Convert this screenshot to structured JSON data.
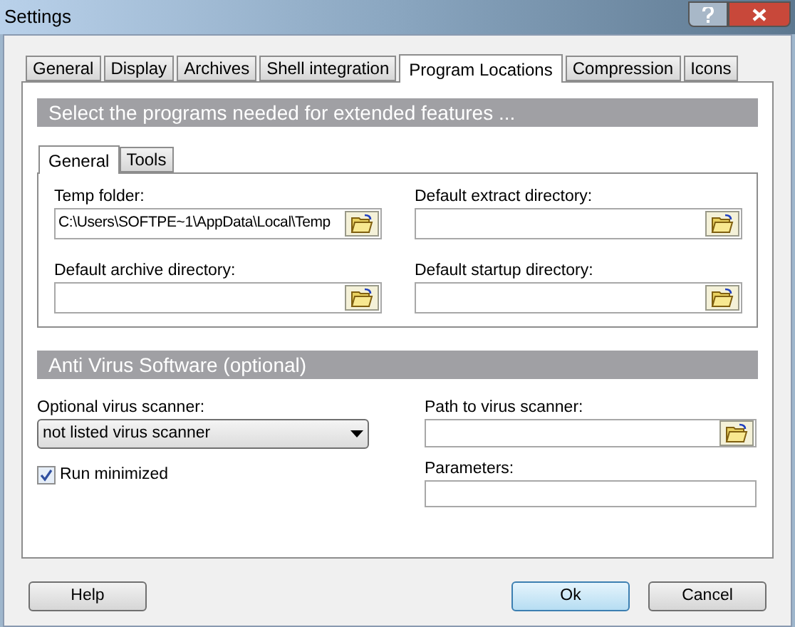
{
  "window": {
    "title": "Settings"
  },
  "tabs": [
    {
      "label": "General",
      "selected": false
    },
    {
      "label": "Display",
      "selected": false
    },
    {
      "label": "Archives",
      "selected": false
    },
    {
      "label": "Shell integration",
      "selected": false
    },
    {
      "label": "Program Locations",
      "selected": true
    },
    {
      "label": "Compression",
      "selected": false
    },
    {
      "label": "Icons",
      "selected": false
    }
  ],
  "programs_section": {
    "heading": "Select the programs needed for extended features ...",
    "tabs": [
      {
        "label": "General",
        "selected": true
      },
      {
        "label": "Tools",
        "selected": false
      }
    ],
    "fields": [
      {
        "label": "Temp folder:",
        "value": "C:\\Users\\SOFTPE~1\\AppData\\Local\\Temp"
      },
      {
        "label": "Default extract directory:"
      },
      {
        "label": "Default archive directory:"
      },
      {
        "label": "Default startup directory:"
      }
    ]
  },
  "antivirus_section": {
    "heading": "Anti Virus Software (optional)",
    "scanner": {
      "label": "Optional virus scanner:",
      "value": "not listed virus scanner"
    },
    "run_minimized": {
      "label": "Run minimized",
      "checked": true
    },
    "path": {
      "label": "Path to virus scanner:"
    },
    "parameters": {
      "label": "Parameters:"
    }
  },
  "buttons": [
    {
      "label": "Help",
      "default": false
    },
    {
      "label": "Ok",
      "default": true
    },
    {
      "label": "Cancel",
      "default": false
    }
  ]
}
